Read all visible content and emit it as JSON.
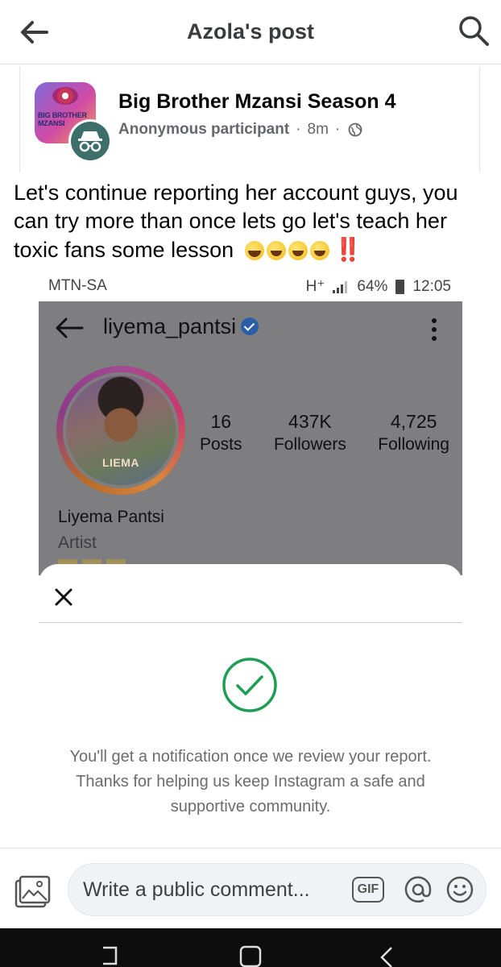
{
  "header": {
    "title": "Azola's post"
  },
  "post": {
    "group_name": "Big Brother Mzansi Season 4",
    "author": "Anonymous participant",
    "separator": "·",
    "time": "8m",
    "avatar_text": "BIG BROTHER MZANSI",
    "text": "Let's continue reporting her account guys, you can try more than once lets go let's teach her toxic fans some lesson",
    "emoji_icons": [
      "crying-face-icon",
      "rolling-laughing-icon",
      "rolling-laughing-icon",
      "rolling-laughing-icon"
    ],
    "exclamation": "‼️"
  },
  "screenshot": {
    "status": {
      "carrier": "MTN-SA",
      "network": "H⁺",
      "battery": "64%",
      "time": "12:05"
    },
    "profile": {
      "username": "liyema_pantsi",
      "avatar_caption": "LIEMA",
      "stats": [
        {
          "value": "16",
          "label": "Posts"
        },
        {
          "value": "437K",
          "label": "Followers"
        },
        {
          "value": "4,725",
          "label": "Following"
        }
      ],
      "name": "Liyema Pantsi",
      "category": "Artist"
    },
    "sheet": {
      "message": "You'll get a notification once we review your report. Thanks for helping us keep Instagram a safe and supportive community."
    }
  },
  "comment": {
    "placeholder": "Write a public comment...",
    "gif_label": "GIF"
  },
  "colors": {
    "check_green": "#1f9d55",
    "overlay_gray": "#7e7e80",
    "verified_blue": "#2a5fa8"
  }
}
